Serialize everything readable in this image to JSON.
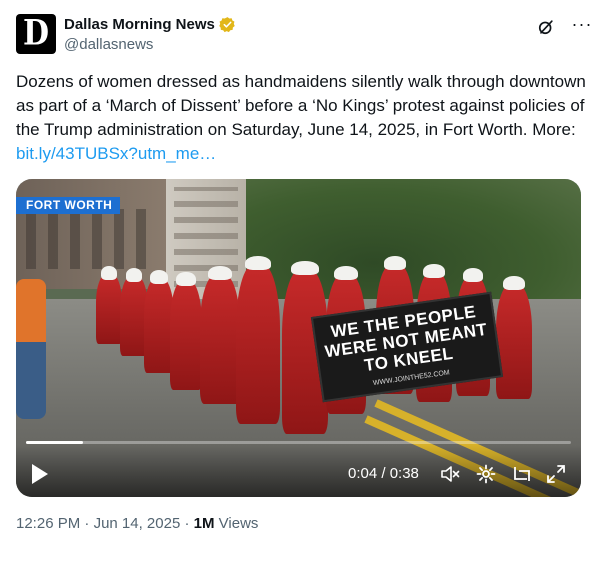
{
  "author": {
    "display_name": "Dallas Morning News",
    "handle": "@dallasnews",
    "avatar_letter": "D",
    "verified_badge": "gold-check"
  },
  "tweet": {
    "text": "Dozens of women dressed as handmaidens silently walk through downtown as part of a ‘March of Dissent’ before a ‘No Kings’ protest against policies of the Trump administration on Saturday, June 14, 2025, in Fort Worth. More: ",
    "link": "bit.ly/43TUBSx?utm_me…"
  },
  "media": {
    "location_label": "FORT WORTH",
    "banner_lines": [
      "WE THE PEOPLE",
      "WERE NOT MEANT",
      "TO KNEEL"
    ],
    "banner_url": "WWW.JOINTHE52.COM",
    "time_display": "0:04 / 0:38",
    "progress_fraction": 0.105
  },
  "meta": {
    "time": "12:26 PM",
    "date": "Jun 14, 2025",
    "views_count": "1M",
    "views_label": "Views",
    "separator": "·"
  },
  "colors": {
    "link": "#1d9bf0",
    "secondary_text": "#536471",
    "badge": "#1d6fd1",
    "verified": "#e2b719"
  }
}
